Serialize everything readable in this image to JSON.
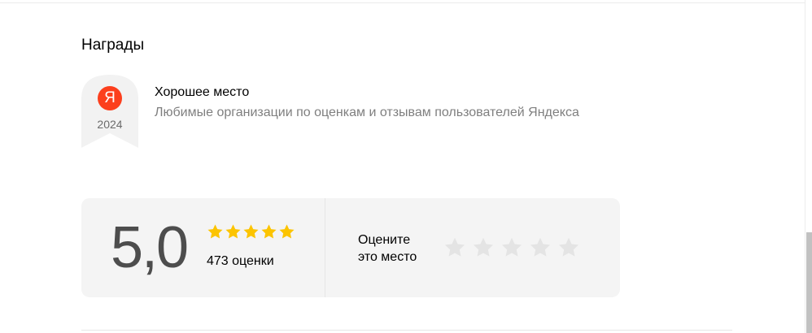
{
  "awards": {
    "section_title": "Награды",
    "items": [
      {
        "badge_logo": "Я",
        "badge_year": "2024",
        "badge_icon": "yandex-logo-icon",
        "title": "Хорошее место",
        "description": "Любимые организации по оценкам и отзывам пользователей Яндекса"
      }
    ]
  },
  "rating": {
    "value": "5,0",
    "stars_filled": 5,
    "stars_total": 5,
    "count_label": "473 оценки",
    "rate_prompt_line1": "Оцените",
    "rate_prompt_line2": "это место",
    "user_rating_stars": 5
  },
  "colors": {
    "star_filled": "#fcc400",
    "star_empty": "#e4e4e4",
    "badge_logo_bg": "#fc3f1d",
    "card_bg": "#f4f4f4"
  }
}
